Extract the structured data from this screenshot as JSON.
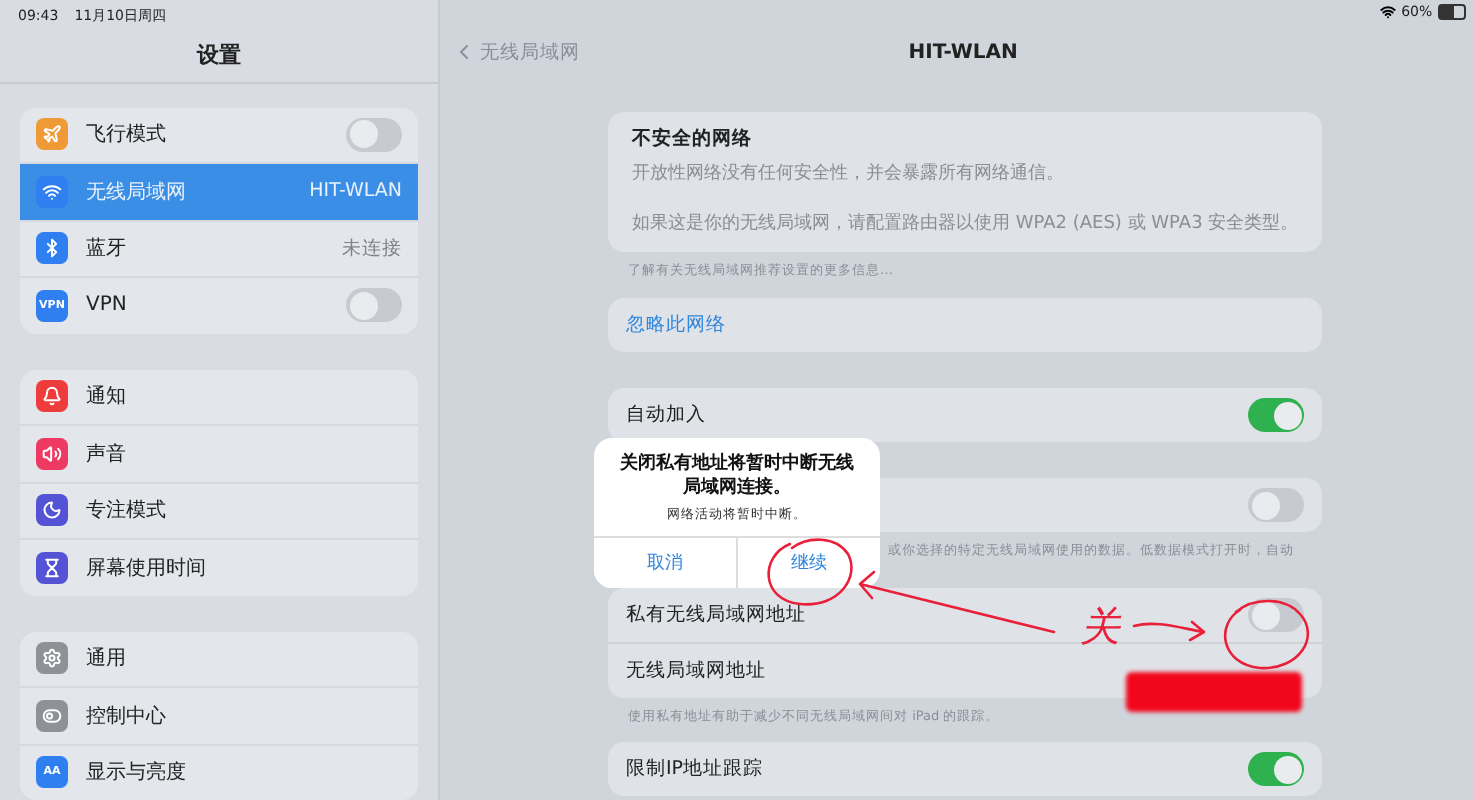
{
  "status_bar": {
    "time": "09:43",
    "date": "11月10日周四",
    "battery": "60%"
  },
  "sidebar": {
    "title": "设置",
    "groups": [
      [
        {
          "kind": "airplane",
          "label": "飞行模式",
          "on": false,
          "selected": false
        },
        {
          "kind": "wifi",
          "label": "无线局域网",
          "value": "HIT-WLAN",
          "selected": true
        },
        {
          "kind": "bluetooth",
          "label": "蓝牙",
          "value": "未连接",
          "selected": false
        },
        {
          "kind": "vpn",
          "icon_text": "VPN",
          "label": "VPN",
          "on": false,
          "selected": false
        }
      ],
      [
        {
          "kind": "notifications",
          "label": "通知",
          "selected": false
        },
        {
          "kind": "sound",
          "label": "声音",
          "selected": false
        },
        {
          "kind": "focus",
          "label": "专注模式",
          "selected": false
        },
        {
          "kind": "screentime",
          "label": "屏幕使用时间",
          "selected": false
        }
      ],
      [
        {
          "kind": "general",
          "label": "通用",
          "selected": false
        },
        {
          "kind": "control",
          "label": "控制中心",
          "selected": false
        },
        {
          "kind": "display",
          "icon_text": "AA",
          "label": "显示与亮度",
          "selected": false
        }
      ]
    ]
  },
  "detail": {
    "back": "无线局域网",
    "title": "HIT-WLAN",
    "warning": {
      "title": "不安全的网络",
      "lines": [
        "开放性网络没有任何安全性，并会暴露所有网络通信。",
        "如果这是你的无线局域网，请配置路由器以使用 WPA2 (AES) 或 WPA3 安全类型。"
      ]
    },
    "warning_footnote": "了解有关无线局域网推荐设置的更多信息…",
    "forget_label": "忽略此网络",
    "auto_join": {
      "label": "自动加入",
      "on": true
    },
    "low_data": {
      "on": false,
      "footnote": "或你选择的特定无线局域网使用的数据。低数据模式打开时，自动"
    },
    "private_address": {
      "label": "私有无线局域网地址",
      "on": false
    },
    "address_label": "无线局域网地址",
    "private_footnote": "使用私有地址有助于减少不同无线局域网间对 iPad 的跟踪。",
    "limit_ip": {
      "label": "限制IP地址跟踪",
      "on": true
    }
  },
  "dialog": {
    "title": "关闭私有地址将暂时中断无线局域网连接。",
    "message": "网络活动将暂时中断。",
    "buttons": [
      "取消",
      "继续"
    ]
  },
  "annotation": {
    "note": "关"
  }
}
